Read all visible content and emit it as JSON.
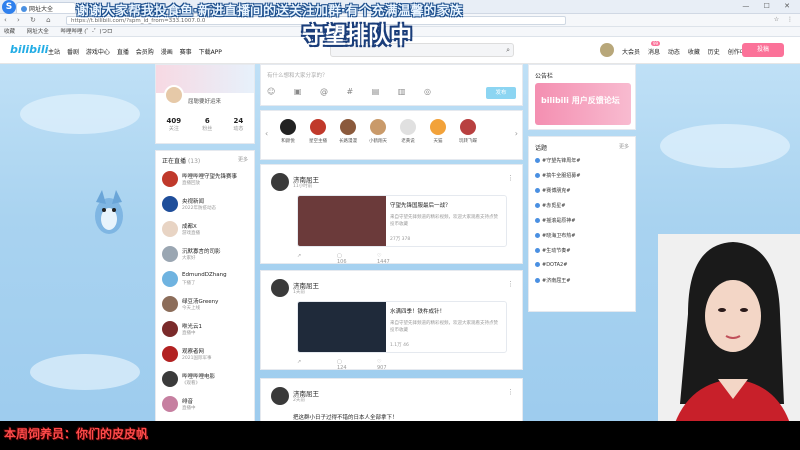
{
  "browser": {
    "tab_title": "网址大全",
    "address": "https://t.bilibili.com/?spm_id_from=333.1007.0.0",
    "bookmarks": [
      "收藏",
      "网址大全",
      "哔哩哔哩 (゜-゜)つロ"
    ]
  },
  "bili": {
    "logo": "bilibili",
    "nav": [
      "主站",
      "番剧",
      "游戏中心",
      "直播",
      "会员购",
      "漫画",
      "赛事"
    ],
    "download": "下载APP",
    "right_nav": [
      "大会员",
      "消息",
      "动态",
      "收藏",
      "历史",
      "创作中心"
    ],
    "vip_badge": "99",
    "post_button": "投稿"
  },
  "profile": {
    "username": "屈聪要好运来",
    "stats": [
      {
        "value": "409",
        "label": "关注"
      },
      {
        "value": "6",
        "label": "粉丝"
      },
      {
        "value": "24",
        "label": "动态"
      }
    ]
  },
  "live": {
    "title": "正在直播",
    "count": "(13)",
    "more": "更多",
    "items": [
      {
        "name": "哔哩哔哩守望先锋赛事",
        "desc": "直播回放",
        "color": "#c0392b"
      },
      {
        "name": "央视新闻",
        "desc": "2022年防疫动态",
        "color": "#1f4e9a"
      },
      {
        "name": "成都X",
        "desc": "游戏直播",
        "color": "#e8d4c4"
      },
      {
        "name": "沉默寡言的司影",
        "desc": "大家好",
        "color": "#9aa6b2"
      },
      {
        "name": "EdmundDZhang",
        "desc": "下播了",
        "color": "#6fb3e0"
      },
      {
        "name": "绿豆汤Greeny",
        "desc": "今天上线",
        "color": "#8c6d5a"
      },
      {
        "name": "咻光云1",
        "desc": "直播中",
        "color": "#7a2a2a"
      },
      {
        "name": "观察者网",
        "desc": "2021国际军事",
        "color": "#b22222"
      },
      {
        "name": "哔哩哔哩电影",
        "desc": "《观看》",
        "color": "#3b3b3b"
      },
      {
        "name": "绯音",
        "desc": "直播中",
        "color": "#c67fa0"
      }
    ]
  },
  "composer": {
    "placeholder": "有什么想和大家分享的？",
    "send": "发布"
  },
  "following": [
    {
      "name": "和颜悦",
      "color": "#222"
    },
    {
      "name": "星空主播",
      "color": "#c0392b"
    },
    {
      "name": "长路漫漫",
      "color": "#8b5a3c"
    },
    {
      "name": "小鹤翔天",
      "color": "#c99a6a"
    },
    {
      "name": "老黄说",
      "color": "#e0e0e0"
    },
    {
      "name": "天猫",
      "color": "#f2a23a"
    },
    {
      "name": "玩转飞蝶",
      "color": "#b84040"
    }
  ],
  "posts": [
    {
      "author": "济南屈王",
      "time": "11小时前",
      "video_title": "守望先锋国服最后一战？",
      "video_desc": "来自守望先锋频道的精彩视频，欢迎大家观看支持点赞投币收藏",
      "video_stats": "27万  378",
      "actions": [
        "",
        "106",
        "1447"
      ],
      "thumb": "#6b3a3a"
    },
    {
      "author": "济南屈王",
      "time": "1天前",
      "video_title": "水满四季！铁杵成针！",
      "video_desc": "来自守望先锋频道的精彩视频，欢迎大家观看支持点赞投币收藏",
      "video_stats": "1.1万  46",
      "actions": [
        "",
        "124",
        "907"
      ],
      "thumb": "#1f2a3a"
    },
    {
      "author": "济南屈王",
      "time": "2天前",
      "video_title": "把这群小日子过得不错的日本人全部拿下！",
      "video_desc": "",
      "video_stats": "",
      "actions": [
        "",
        "",
        ""
      ],
      "thumb": "#444"
    }
  ],
  "right_ad": {
    "title": "公告栏",
    "banner": "bilibili 用户反馈论坛"
  },
  "topics": {
    "title": "话题",
    "more": "更多",
    "items": [
      "#守望先锋周年#",
      "#搞牛全服招募#",
      "#赛博朋克#",
      "#赤觅星#",
      "#摇滚是原神#",
      "#晓海卫布热#",
      "#生动节奏#",
      "#DOTA2#",
      "#济南屈王#"
    ]
  },
  "overlay": {
    "line1": "谢谢大家帮我投食鱼·新进直播间的送关注加群‧有个充满温馨的家族",
    "big": "守望排队中",
    "bottom": "本周饲养员：你们的皮皮帆"
  }
}
